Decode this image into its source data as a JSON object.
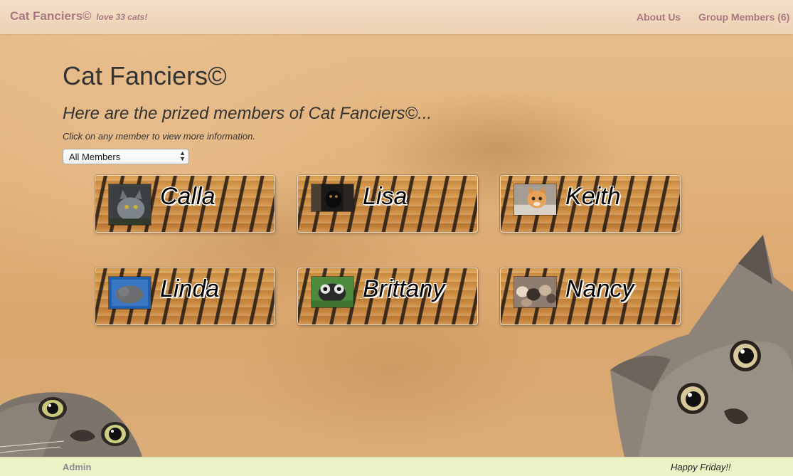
{
  "navbar": {
    "brand": "Cat Fanciers©",
    "brand_tagline": "love 33 cats!",
    "links": {
      "about": "About Us",
      "group_members": "Group Members (6)"
    }
  },
  "main": {
    "title": "Cat Fanciers©",
    "subtitle": "Here are the prized members of Cat Fanciers©...",
    "instruction": "Click on any member to view more information.",
    "filter": {
      "selected": "All Members"
    },
    "members": [
      {
        "name": "Calla"
      },
      {
        "name": "Lisa"
      },
      {
        "name": "Keith"
      },
      {
        "name": "Linda"
      },
      {
        "name": "Brittany"
      },
      {
        "name": "Nancy"
      }
    ]
  },
  "footer": {
    "admin_link": "Admin",
    "message": "Happy Friday!!"
  },
  "colors": {
    "brand_text": "#a8767c",
    "heading_text": "#333333",
    "footer_bg": "#ecf2c6",
    "card_tiger_orange": "#c98a3a"
  }
}
